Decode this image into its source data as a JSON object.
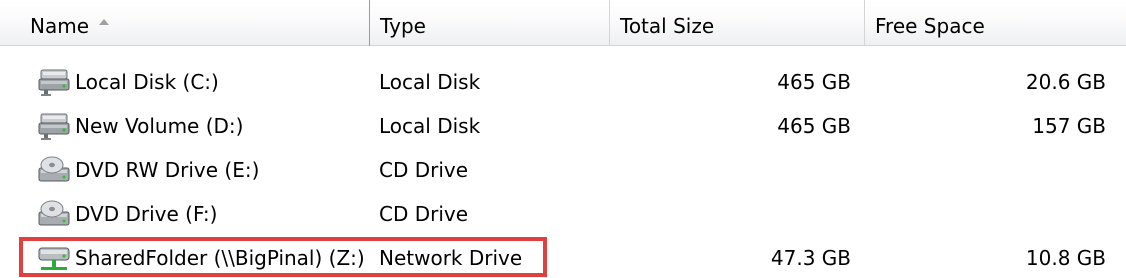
{
  "columns": {
    "name": "Name",
    "type": "Type",
    "total_size": "Total Size",
    "free_space": "Free Space"
  },
  "drives": [
    {
      "icon": "hard-disk-icon",
      "name": "Local Disk (C:)",
      "type": "Local Disk",
      "total_size": "465 GB",
      "free_space": "20.6 GB"
    },
    {
      "icon": "hard-disk-icon",
      "name": "New Volume (D:)",
      "type": "Local Disk",
      "total_size": "465 GB",
      "free_space": "157 GB"
    },
    {
      "icon": "dvd-drive-icon",
      "name": "DVD RW Drive (E:)",
      "type": "CD Drive",
      "total_size": "",
      "free_space": ""
    },
    {
      "icon": "dvd-drive-icon",
      "name": "DVD Drive (F:)",
      "type": "CD Drive",
      "total_size": "",
      "free_space": ""
    },
    {
      "icon": "network-drive-icon",
      "name": "SharedFolder (\\\\BigPinal) (Z:)",
      "type": "Network Drive",
      "total_size": "47.3 GB",
      "free_space": "10.8 GB"
    }
  ],
  "highlight_color": "#e04040"
}
